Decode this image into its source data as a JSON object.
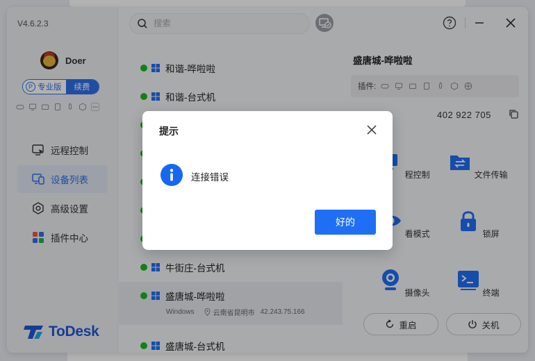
{
  "app": {
    "version": "V4.6.2.3",
    "brand": "ToDesk",
    "accent_color": "#1f6ff5"
  },
  "user": {
    "name": "Doer",
    "plan_label": "专业版",
    "plan_badge": "P",
    "renew_label": "续费",
    "plugin_icons": [
      "gamepad-icon",
      "monitor-icon",
      "folder-icon",
      "tablet-icon",
      "rocket-icon",
      "hexagon-icon",
      "more-icon"
    ]
  },
  "sidebar": {
    "items": [
      {
        "label": "远程控制",
        "icon": "remote-control-icon",
        "active": false
      },
      {
        "label": "设备列表",
        "icon": "device-list-icon",
        "active": true
      },
      {
        "label": "高级设置",
        "icon": "settings-icon",
        "active": false
      },
      {
        "label": "插件中心",
        "icon": "plugin-center-icon",
        "active": false
      }
    ]
  },
  "header": {
    "search_placeholder": "搜索",
    "icons": [
      "add-device-icon",
      "help-icon",
      "minimize-icon",
      "close-icon"
    ]
  },
  "devices": [
    {
      "name": "和谐-哗啦啦",
      "online": true
    },
    {
      "name": "和谐-台式机",
      "online": true
    },
    {
      "name": "",
      "online": true
    },
    {
      "name": "",
      "online": true
    },
    {
      "name": "",
      "online": true
    },
    {
      "name": "",
      "online": true
    },
    {
      "name": "",
      "online": true
    },
    {
      "name": "牛街庄-台式机",
      "online": true
    },
    {
      "name": "盛唐城-哗啦啦",
      "online": true,
      "selected": true,
      "os": "Windows",
      "location": "云南省昆明市",
      "ip": "42.243.75.166"
    },
    {
      "name": "盛唐城-台式机",
      "online": true
    }
  ],
  "detail": {
    "title": "盛唐城-哗啦啦",
    "plugins_label": "插件:",
    "device_id": "402 922 705",
    "actions": [
      {
        "label": "程控制",
        "icon": "remote-control-icon"
      },
      {
        "label": "文件传输",
        "icon": "file-transfer-icon"
      },
      {
        "label": "看模式",
        "icon": "eye-icon"
      },
      {
        "label": "锁屏",
        "icon": "lock-icon"
      },
      {
        "label": "摄像头",
        "icon": "camera-icon"
      },
      {
        "label": "终端",
        "icon": "terminal-icon"
      }
    ],
    "restart_label": "重启",
    "shutdown_label": "关机"
  },
  "dialog": {
    "title": "提示",
    "message": "连接错误",
    "ok_label": "好的"
  }
}
